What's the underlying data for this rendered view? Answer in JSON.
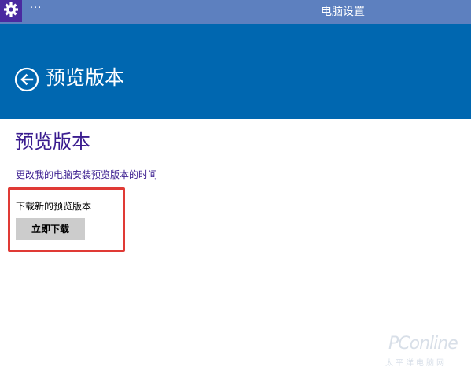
{
  "titlebar": {
    "menu_dots": "···",
    "title": "电脑设置",
    "color": "#5d80bf",
    "icon": "gear-icon"
  },
  "header": {
    "title": "预览版本",
    "color": "#0067b0",
    "back_icon": "back-arrow-icon"
  },
  "content": {
    "section_title": "预览版本",
    "schedule_link": "更改我的电脑安装预览版本的时间",
    "download_label": "下载新的预览版本",
    "download_button": "立即下载",
    "highlight_color": "#e03a35"
  },
  "watermark": {
    "brand": "PConline",
    "sub": "太平洋电脑网"
  }
}
